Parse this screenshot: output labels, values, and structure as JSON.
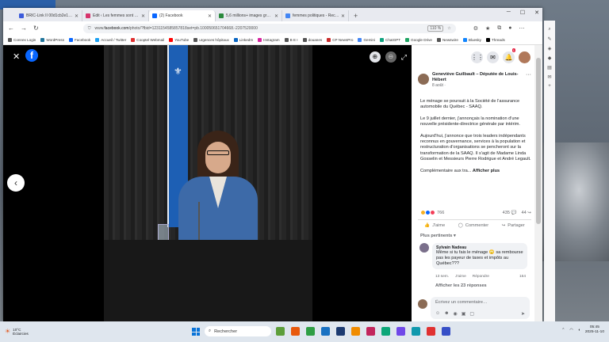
{
  "browser": {
    "tabs": [
      {
        "label": "BRIC-Link II 00d1cb2e13d5 (E",
        "color": "#3b5bdb",
        "active": false
      },
      {
        "label": "Edit ‹ Les femmes sont de plus",
        "color": "#d6336c",
        "active": false
      },
      {
        "label": "(2) Facebook",
        "color": "#0866ff",
        "active": true
      },
      {
        "label": "5,6 millions+ images gratuites",
        "color": "#2b8a3e",
        "active": false
      },
      {
        "label": "femmes politiques - Recherche",
        "color": "#4285f4",
        "active": false
      }
    ],
    "new_tab": "+",
    "url_prefix": "www.",
    "url_host": "facebook.com",
    "url_path": "/photo/?fbid=1231154585857818set=pb.100050651704668.-2207520000",
    "zoom": "110 %",
    "bookmarks": [
      {
        "label": "Connex Login",
        "color": "#555"
      },
      {
        "label": "WordPress",
        "color": "#21759b"
      },
      {
        "label": "Facebook",
        "color": "#0866ff"
      },
      {
        "label": "Accueil / Twitter",
        "color": "#1da1f2"
      },
      {
        "label": "Cooptel Webmail",
        "color": "#e03131"
      },
      {
        "label": "YouTube",
        "color": "#ff0000"
      },
      {
        "label": "urgences hôpitaux",
        "color": "#555"
      },
      {
        "label": "LinkedIn",
        "color": "#0a66c2"
      },
      {
        "label": "Instagram",
        "color": "#d6249f"
      },
      {
        "label": "B E I",
        "color": "#555"
      },
      {
        "label": "douanes",
        "color": "#555"
      },
      {
        "label": "CP NewsPro",
        "color": "#c92a2a"
      },
      {
        "label": "Gemini",
        "color": "#4285f4"
      },
      {
        "label": "ChatGPT",
        "color": "#10a37f"
      },
      {
        "label": "Google Drive",
        "color": "#1fa463"
      },
      {
        "label": "Newswire",
        "color": "#555"
      },
      {
        "label": "Bluesky",
        "color": "#1185fe"
      },
      {
        "label": "Threads",
        "color": "#000"
      }
    ]
  },
  "viewer": {
    "close": "✕",
    "logo": "f",
    "zoom_in": "⊕",
    "zoom_out": "⊖",
    "expand": "⤢",
    "prev": "‹"
  },
  "panel": {
    "notif_count": "1",
    "author": "Geneviève Guilbault – Députée de Louis-Hébert",
    "date": "8 août ·",
    "more": "···",
    "paragraphs": [
      "Le ménage se poursuit à la Société de l'assurance automobile du Québec - SAAQ.",
      "Le 9 juillet dernier, j'annonçais la nomination d'une nouvelle présidente-directrice générale par intérim.",
      "Aujourd'hui, j'annonce que trois leaders indépendants reconnus en gouvernance, services à la population et restructuration d'organisations se pencheront sur la transformation de la SAAQ. Il s'agit de Madame Linda Gosselin et Messieurs Pierre Rodrigue et André Legault."
    ],
    "truncated": "Complémentaire aux tra...",
    "see_more": "Afficher plus",
    "reaction_count": "766",
    "comment_count": "435",
    "share_count": "44",
    "actions": {
      "like": "J'aime",
      "comment": "Commenter",
      "share": "Partager"
    },
    "relevant": "Plus pertinents ▾",
    "comment": {
      "name": "Sylvain Nadeau",
      "text": "Même si tu fais le ménage 🙄 sa rembourse pas les payeur de taxes et impôts au Québec???",
      "time": "13 sem.",
      "like": "J'aime",
      "reply": "Répondre",
      "likes": "164"
    },
    "view_replies": "Afficher les 23 réponses",
    "composer_placeholder": "Écrivez un commentaire…"
  },
  "taskbar": {
    "temp": "10°C",
    "weather": "Éclaircies",
    "search": "Rechercher",
    "time": "05:45",
    "date": "2025-11-10",
    "apps": [
      "#5d9e3a",
      "#e8590c",
      "#2f9e44",
      "#1971c2",
      "#1c3a70",
      "#f08c00",
      "#c2255c",
      "#0ca678",
      "#7048e8",
      "#1098ad",
      "#e03131",
      "#364fc7"
    ]
  }
}
